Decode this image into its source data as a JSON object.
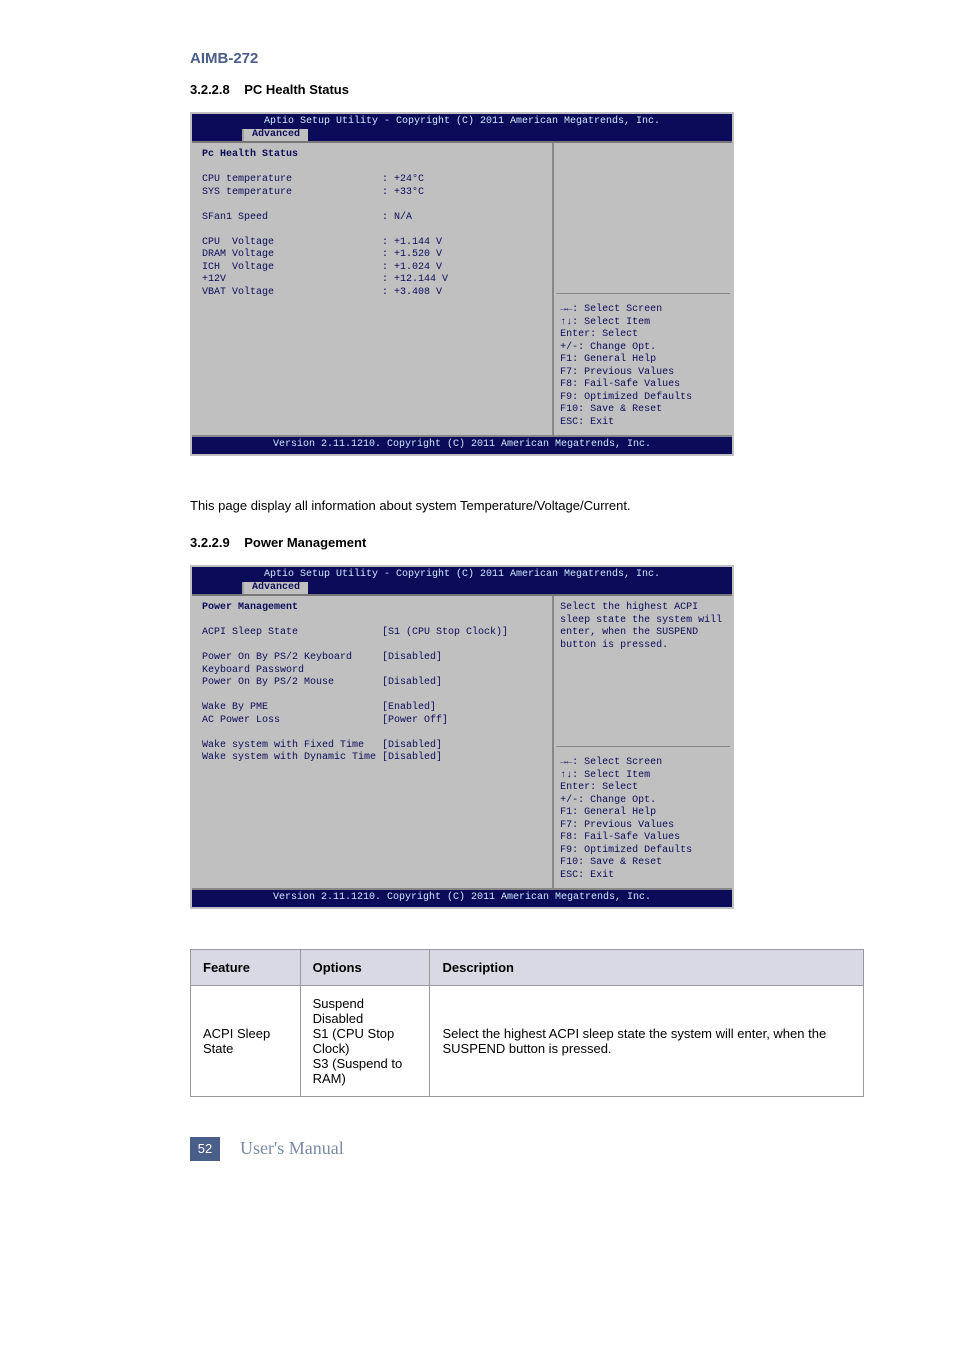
{
  "product": "AIMB-272",
  "section1": {
    "num": "3.2.2.8",
    "title": "PC Health Status"
  },
  "bios1": {
    "title": "Aptio Setup Utility - Copyright (C) 2011 American Megatrends, Inc.",
    "tab": "Advanced",
    "heading": "Pc Health Status",
    "rows": [
      {
        "label": "CPU temperature",
        "value": ": +24°C"
      },
      {
        "label": "SYS temperature",
        "value": ": +33°C"
      },
      {
        "label": "",
        "value": ""
      },
      {
        "label": "SFan1 Speed",
        "value": ": N/A"
      },
      {
        "label": "",
        "value": ""
      },
      {
        "label": "CPU  Voltage",
        "value": ": +1.144 V"
      },
      {
        "label": "DRAM Voltage",
        "value": ": +1.520 V"
      },
      {
        "label": "ICH  Voltage",
        "value": ": +1.024 V"
      },
      {
        "label": "+12V",
        "value": ": +12.144 V"
      },
      {
        "label": "VBAT Voltage",
        "value": ": +3.408 V"
      }
    ],
    "keys": [
      "→←: Select Screen",
      "↑↓: Select Item",
      "Enter: Select",
      "+/-: Change Opt.",
      "F1: General Help",
      "F7: Previous Values",
      "F8: Fail-Safe Values",
      "F9: Optimized Defaults",
      "F10: Save & Reset",
      "ESC: Exit"
    ],
    "footer": "Version 2.11.1210. Copyright (C) 2011 American Megatrends, Inc."
  },
  "para1": "This page display all information about system Temperature/Voltage/Current.",
  "section2": {
    "num": "3.2.2.9",
    "title": "Power Management"
  },
  "bios2": {
    "title": "Aptio Setup Utility - Copyright (C) 2011 American Megatrends, Inc.",
    "tab": "Advanced",
    "heading": "Power Management",
    "rows": [
      {
        "label": "ACPI Sleep State",
        "value": "[S1 (CPU Stop Clock)]"
      },
      {
        "label": "",
        "value": ""
      },
      {
        "label": "Power On By PS/2 Keyboard",
        "value": "[Disabled]"
      },
      {
        "label": "Keyboard Password",
        "value": ""
      },
      {
        "label": "Power On By PS/2 Mouse",
        "value": "[Disabled]"
      },
      {
        "label": "",
        "value": ""
      },
      {
        "label": "Wake By PME",
        "value": "[Enabled]"
      },
      {
        "label": "AC Power Loss",
        "value": "[Power Off]"
      },
      {
        "label": "",
        "value": ""
      },
      {
        "label": "Wake system with Fixed Time",
        "value": "[Disabled]"
      },
      {
        "label": "Wake system with Dynamic Time",
        "value": "[Disabled]"
      }
    ],
    "help": "Select the highest ACPI sleep state the system will enter, when the SUSPEND button is pressed.",
    "keys": [
      "→←: Select Screen",
      "↑↓: Select Item",
      "Enter: Select",
      "+/-: Change Opt.",
      "F1: General Help",
      "F7: Previous Values",
      "F8: Fail-Safe Values",
      "F9: Optimized Defaults",
      "F10: Save & Reset",
      "ESC: Exit"
    ],
    "footer": "Version 2.11.1210. Copyright (C) 2011 American Megatrends, Inc."
  },
  "table": {
    "headers": [
      "Feature",
      "Options",
      "Description"
    ],
    "rows": [
      [
        "ACPI Sleep State",
        "Suspend Disabled\nS1 (CPU Stop Clock)\nS3 (Suspend to RAM)",
        "Select the highest ACPI sleep state the system will enter, when the SUSPEND button is pressed."
      ]
    ]
  },
  "footer": {
    "page": "52",
    "text": "User's Manual"
  }
}
